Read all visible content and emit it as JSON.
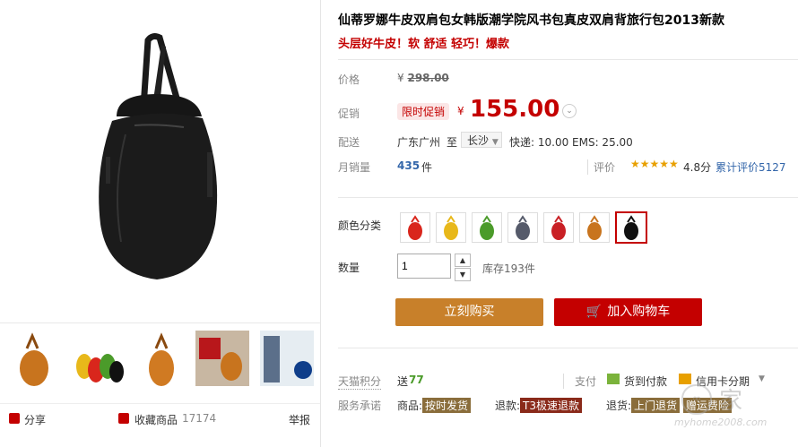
{
  "product": {
    "title": "仙蒂罗娜牛皮双肩包女韩版潮学院风书包真皮双肩背旅行包2013新款",
    "subtitle": "头层好牛皮！软 舒适 轻巧！爆款"
  },
  "price": {
    "label": "价格",
    "currency": "¥",
    "original": "298.00",
    "promo_label": "促销",
    "promo_tag": "限时促销",
    "promo_price": "155.00"
  },
  "shipping": {
    "label": "配送",
    "from": "广东广州",
    "to_word": "至",
    "destination": "长沙",
    "fees": "快递: 10.00 EMS: 25.00"
  },
  "sales": {
    "label": "月销量",
    "count": "435",
    "unit": "件",
    "rating_label": "评价",
    "stars": "★★★★★",
    "score": "4.8分",
    "review_text": "累计评价5127"
  },
  "color": {
    "label": "颜色分类",
    "swatches": [
      {
        "name": "red",
        "color": "#d9261c"
      },
      {
        "name": "yellow",
        "color": "#e8b81a"
      },
      {
        "name": "green",
        "color": "#4b9b2a"
      },
      {
        "name": "model",
        "color": "#555a6a"
      },
      {
        "name": "red2",
        "color": "#c92025"
      },
      {
        "name": "tan",
        "color": "#c8741e"
      },
      {
        "name": "black",
        "color": "#111111"
      }
    ]
  },
  "quantity": {
    "label": "数量",
    "value": "1",
    "stock": "库存193件"
  },
  "buttons": {
    "buy_now": "立刻购买",
    "add_cart": "加入购物车"
  },
  "points": {
    "label": "天猫积分",
    "send": "送",
    "value": "77",
    "pay_label": "支付",
    "cod": "货到付款",
    "credit": "信用卡分期"
  },
  "service": {
    "label": "服务承诺",
    "goods": "商品:",
    "goods_tag": "按时发货",
    "refund": "退款:",
    "refund_tag": "T3极速退款",
    "return": "退货:",
    "return_tag": "上门退货",
    "freight_tag": "赠运费险"
  },
  "share": {
    "share_label": "分享",
    "fav_label": "收藏商品",
    "fav_count": "17174",
    "report": "举报"
  },
  "watermark": {
    "text": "家",
    "domain": "myhome2008.com"
  }
}
